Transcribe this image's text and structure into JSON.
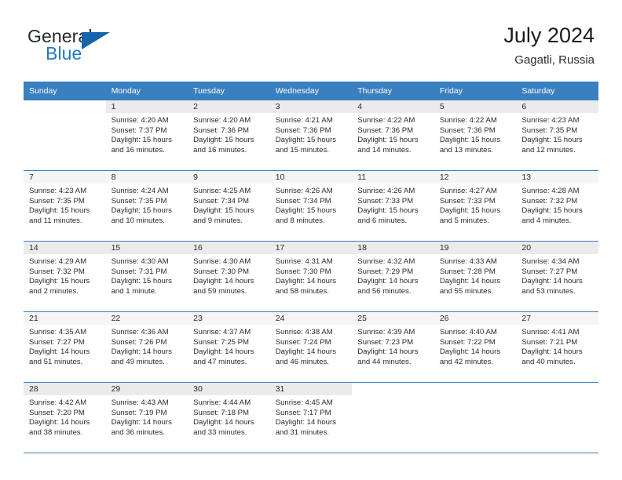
{
  "brand": {
    "word_top": "General",
    "word_bottom": "Blue",
    "flag_icon": "triangle-flag-icon",
    "accent_color": "#1565ad"
  },
  "header": {
    "title": "July 2024",
    "location": "Gagatli, Russia"
  },
  "calendar": {
    "header_bg": "#3a7fc0",
    "weekday_headers": [
      "Sunday",
      "Monday",
      "Tuesday",
      "Wednesday",
      "Thursday",
      "Friday",
      "Saturday"
    ],
    "weeks": [
      [
        {
          "day": ""
        },
        {
          "day": "1",
          "sunrise": "Sunrise: 4:20 AM",
          "sunset": "Sunset: 7:37 PM",
          "daylight_l1": "Daylight: 15 hours",
          "daylight_l2": "and 16 minutes."
        },
        {
          "day": "2",
          "sunrise": "Sunrise: 4:20 AM",
          "sunset": "Sunset: 7:36 PM",
          "daylight_l1": "Daylight: 15 hours",
          "daylight_l2": "and 16 minutes."
        },
        {
          "day": "3",
          "sunrise": "Sunrise: 4:21 AM",
          "sunset": "Sunset: 7:36 PM",
          "daylight_l1": "Daylight: 15 hours",
          "daylight_l2": "and 15 minutes."
        },
        {
          "day": "4",
          "sunrise": "Sunrise: 4:22 AM",
          "sunset": "Sunset: 7:36 PM",
          "daylight_l1": "Daylight: 15 hours",
          "daylight_l2": "and 14 minutes."
        },
        {
          "day": "5",
          "sunrise": "Sunrise: 4:22 AM",
          "sunset": "Sunset: 7:36 PM",
          "daylight_l1": "Daylight: 15 hours",
          "daylight_l2": "and 13 minutes."
        },
        {
          "day": "6",
          "sunrise": "Sunrise: 4:23 AM",
          "sunset": "Sunset: 7:35 PM",
          "daylight_l1": "Daylight: 15 hours",
          "daylight_l2": "and 12 minutes."
        }
      ],
      [
        {
          "day": "7",
          "sunrise": "Sunrise: 4:23 AM",
          "sunset": "Sunset: 7:35 PM",
          "daylight_l1": "Daylight: 15 hours",
          "daylight_l2": "and 11 minutes."
        },
        {
          "day": "8",
          "sunrise": "Sunrise: 4:24 AM",
          "sunset": "Sunset: 7:35 PM",
          "daylight_l1": "Daylight: 15 hours",
          "daylight_l2": "and 10 minutes."
        },
        {
          "day": "9",
          "sunrise": "Sunrise: 4:25 AM",
          "sunset": "Sunset: 7:34 PM",
          "daylight_l1": "Daylight: 15 hours",
          "daylight_l2": "and 9 minutes."
        },
        {
          "day": "10",
          "sunrise": "Sunrise: 4:26 AM",
          "sunset": "Sunset: 7:34 PM",
          "daylight_l1": "Daylight: 15 hours",
          "daylight_l2": "and 8 minutes."
        },
        {
          "day": "11",
          "sunrise": "Sunrise: 4:26 AM",
          "sunset": "Sunset: 7:33 PM",
          "daylight_l1": "Daylight: 15 hours",
          "daylight_l2": "and 6 minutes."
        },
        {
          "day": "12",
          "sunrise": "Sunrise: 4:27 AM",
          "sunset": "Sunset: 7:33 PM",
          "daylight_l1": "Daylight: 15 hours",
          "daylight_l2": "and 5 minutes."
        },
        {
          "day": "13",
          "sunrise": "Sunrise: 4:28 AM",
          "sunset": "Sunset: 7:32 PM",
          "daylight_l1": "Daylight: 15 hours",
          "daylight_l2": "and 4 minutes."
        }
      ],
      [
        {
          "day": "14",
          "sunrise": "Sunrise: 4:29 AM",
          "sunset": "Sunset: 7:32 PM",
          "daylight_l1": "Daylight: 15 hours",
          "daylight_l2": "and 2 minutes."
        },
        {
          "day": "15",
          "sunrise": "Sunrise: 4:30 AM",
          "sunset": "Sunset: 7:31 PM",
          "daylight_l1": "Daylight: 15 hours",
          "daylight_l2": "and 1 minute."
        },
        {
          "day": "16",
          "sunrise": "Sunrise: 4:30 AM",
          "sunset": "Sunset: 7:30 PM",
          "daylight_l1": "Daylight: 14 hours",
          "daylight_l2": "and 59 minutes."
        },
        {
          "day": "17",
          "sunrise": "Sunrise: 4:31 AM",
          "sunset": "Sunset: 7:30 PM",
          "daylight_l1": "Daylight: 14 hours",
          "daylight_l2": "and 58 minutes."
        },
        {
          "day": "18",
          "sunrise": "Sunrise: 4:32 AM",
          "sunset": "Sunset: 7:29 PM",
          "daylight_l1": "Daylight: 14 hours",
          "daylight_l2": "and 56 minutes."
        },
        {
          "day": "19",
          "sunrise": "Sunrise: 4:33 AM",
          "sunset": "Sunset: 7:28 PM",
          "daylight_l1": "Daylight: 14 hours",
          "daylight_l2": "and 55 minutes."
        },
        {
          "day": "20",
          "sunrise": "Sunrise: 4:34 AM",
          "sunset": "Sunset: 7:27 PM",
          "daylight_l1": "Daylight: 14 hours",
          "daylight_l2": "and 53 minutes."
        }
      ],
      [
        {
          "day": "21",
          "sunrise": "Sunrise: 4:35 AM",
          "sunset": "Sunset: 7:27 PM",
          "daylight_l1": "Daylight: 14 hours",
          "daylight_l2": "and 51 minutes."
        },
        {
          "day": "22",
          "sunrise": "Sunrise: 4:36 AM",
          "sunset": "Sunset: 7:26 PM",
          "daylight_l1": "Daylight: 14 hours",
          "daylight_l2": "and 49 minutes."
        },
        {
          "day": "23",
          "sunrise": "Sunrise: 4:37 AM",
          "sunset": "Sunset: 7:25 PM",
          "daylight_l1": "Daylight: 14 hours",
          "daylight_l2": "and 47 minutes."
        },
        {
          "day": "24",
          "sunrise": "Sunrise: 4:38 AM",
          "sunset": "Sunset: 7:24 PM",
          "daylight_l1": "Daylight: 14 hours",
          "daylight_l2": "and 46 minutes."
        },
        {
          "day": "25",
          "sunrise": "Sunrise: 4:39 AM",
          "sunset": "Sunset: 7:23 PM",
          "daylight_l1": "Daylight: 14 hours",
          "daylight_l2": "and 44 minutes."
        },
        {
          "day": "26",
          "sunrise": "Sunrise: 4:40 AM",
          "sunset": "Sunset: 7:22 PM",
          "daylight_l1": "Daylight: 14 hours",
          "daylight_l2": "and 42 minutes."
        },
        {
          "day": "27",
          "sunrise": "Sunrise: 4:41 AM",
          "sunset": "Sunset: 7:21 PM",
          "daylight_l1": "Daylight: 14 hours",
          "daylight_l2": "and 40 minutes."
        }
      ],
      [
        {
          "day": "28",
          "sunrise": "Sunrise: 4:42 AM",
          "sunset": "Sunset: 7:20 PM",
          "daylight_l1": "Daylight: 14 hours",
          "daylight_l2": "and 38 minutes."
        },
        {
          "day": "29",
          "sunrise": "Sunrise: 4:43 AM",
          "sunset": "Sunset: 7:19 PM",
          "daylight_l1": "Daylight: 14 hours",
          "daylight_l2": "and 36 minutes."
        },
        {
          "day": "30",
          "sunrise": "Sunrise: 4:44 AM",
          "sunset": "Sunset: 7:18 PM",
          "daylight_l1": "Daylight: 14 hours",
          "daylight_l2": "and 33 minutes."
        },
        {
          "day": "31",
          "sunrise": "Sunrise: 4:45 AM",
          "sunset": "Sunset: 7:17 PM",
          "daylight_l1": "Daylight: 14 hours",
          "daylight_l2": "and 31 minutes."
        },
        {
          "day": ""
        },
        {
          "day": ""
        },
        {
          "day": ""
        }
      ]
    ]
  }
}
